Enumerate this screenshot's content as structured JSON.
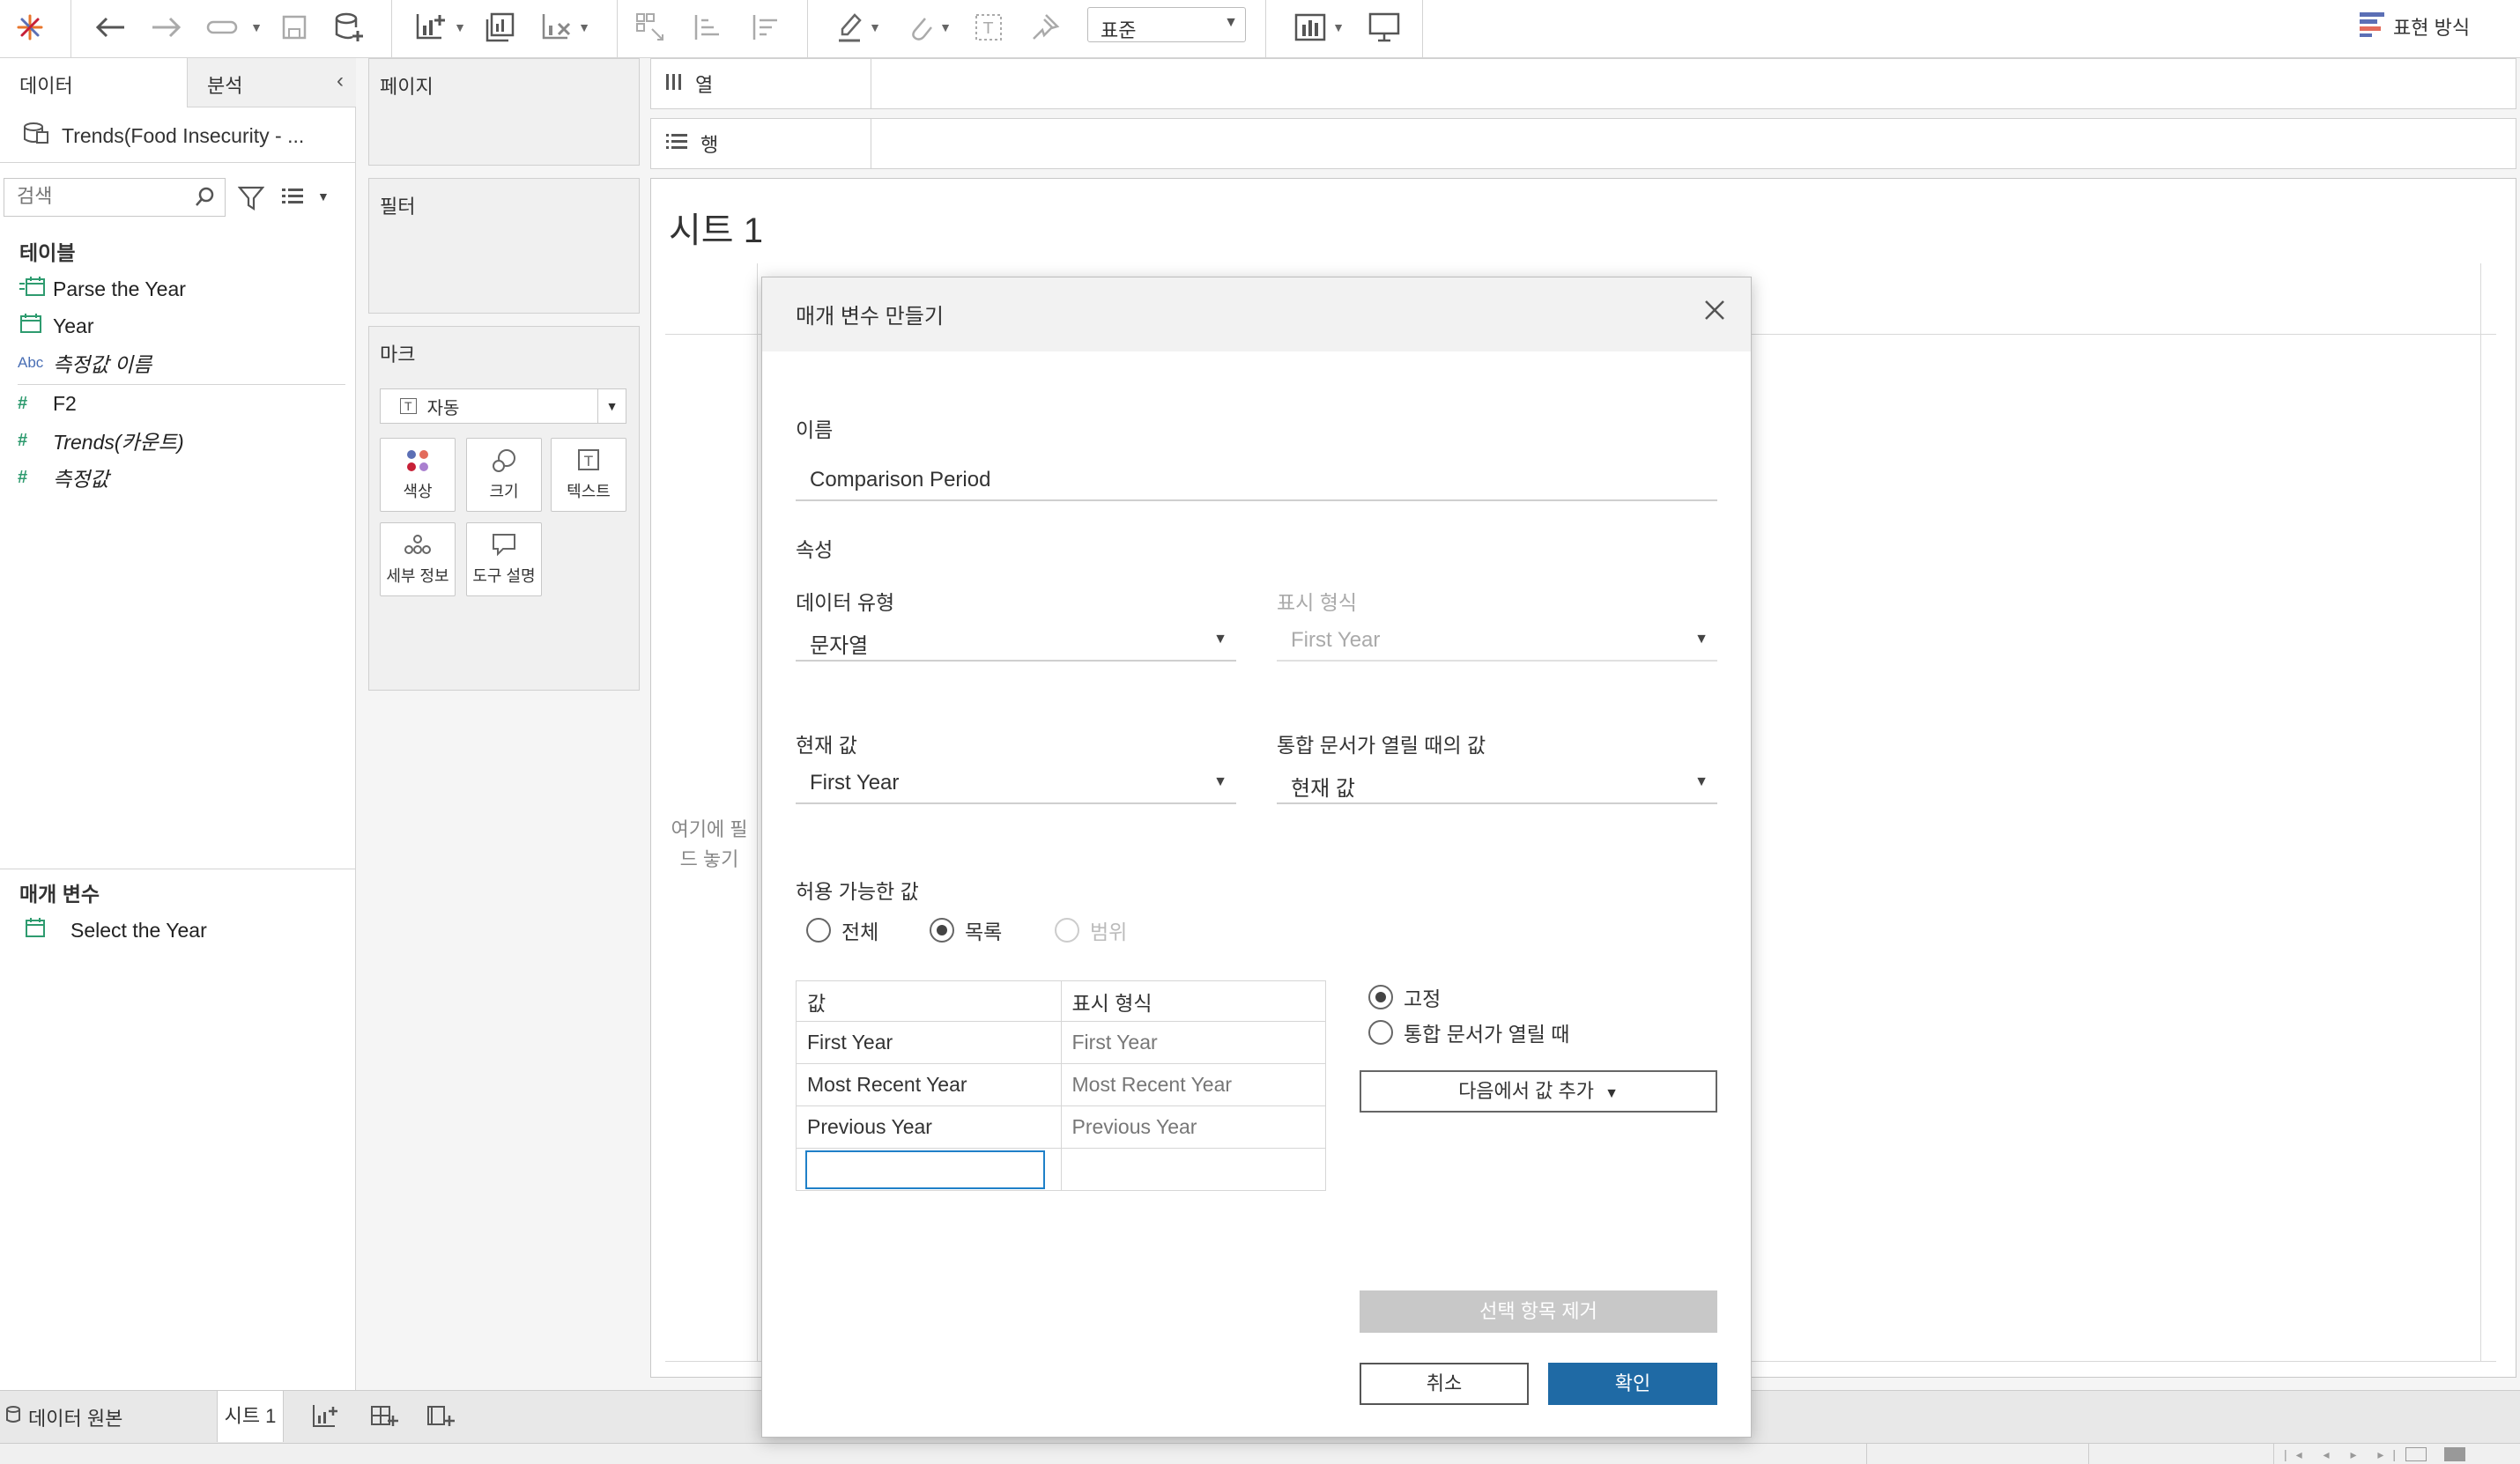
{
  "toolbar": {
    "view_mode": "표준",
    "show_me": "표현 방식"
  },
  "data_pane": {
    "tab_data": "데이터",
    "tab_analysis": "분석",
    "datasource": "Trends(Food Insecurity - ...",
    "search_placeholder": "검색",
    "tables_header": "테이블",
    "fields": [
      {
        "label": "Parse the Year"
      },
      {
        "label": "Year"
      },
      {
        "label": "측정값 이름"
      },
      {
        "label": "F2"
      },
      {
        "label": "Trends(카운트)"
      },
      {
        "label": "측정값"
      }
    ],
    "params_header": "매개 변수",
    "params": [
      {
        "label": "Select the Year"
      }
    ],
    "abc": "Abc"
  },
  "shelves": {
    "pages": "페이지",
    "filters": "필터",
    "marks": "마크",
    "mark_type": "자동",
    "mark_buttons": [
      "색상",
      "크기",
      "텍스트",
      "세부 정보",
      "도구 설명"
    ],
    "columns": "열",
    "rows": "행"
  },
  "sheet": {
    "title": "시트 1",
    "drop_hint": "여기에 필드 놓기"
  },
  "tabbar": {
    "datasource_tab": "데이터 원본",
    "sheet_tab": "시트 1"
  },
  "dialog": {
    "title": "매개 변수 만들기",
    "name_label": "이름",
    "name_value": "Comparison Period",
    "properties_label": "속성",
    "data_type_label": "데이터 유형",
    "data_type_value": "문자열",
    "display_format_label": "표시 형식",
    "display_format_value": "First Year",
    "current_value_label": "현재 값",
    "current_value": "First Year",
    "open_value_label": "통합 문서가 열릴 때의 값",
    "open_value": "현재 값",
    "allowable_label": "허용 가능한 값",
    "allow_all": "전체",
    "allow_list": "목록",
    "allow_range": "범위",
    "col_value": "값",
    "col_display": "표시 형식",
    "rows": [
      {
        "value": "First Year",
        "display": "First Year"
      },
      {
        "value": "Most Recent Year",
        "display": "Most Recent Year"
      },
      {
        "value": "Previous Year",
        "display": "Previous Year"
      }
    ],
    "fixed": "고정",
    "when_open": "통합 문서가 열릴 때",
    "add_from": "다음에서 값 추가",
    "remove_selected": "선택 항목 제거",
    "cancel": "취소",
    "ok": "확인"
  }
}
